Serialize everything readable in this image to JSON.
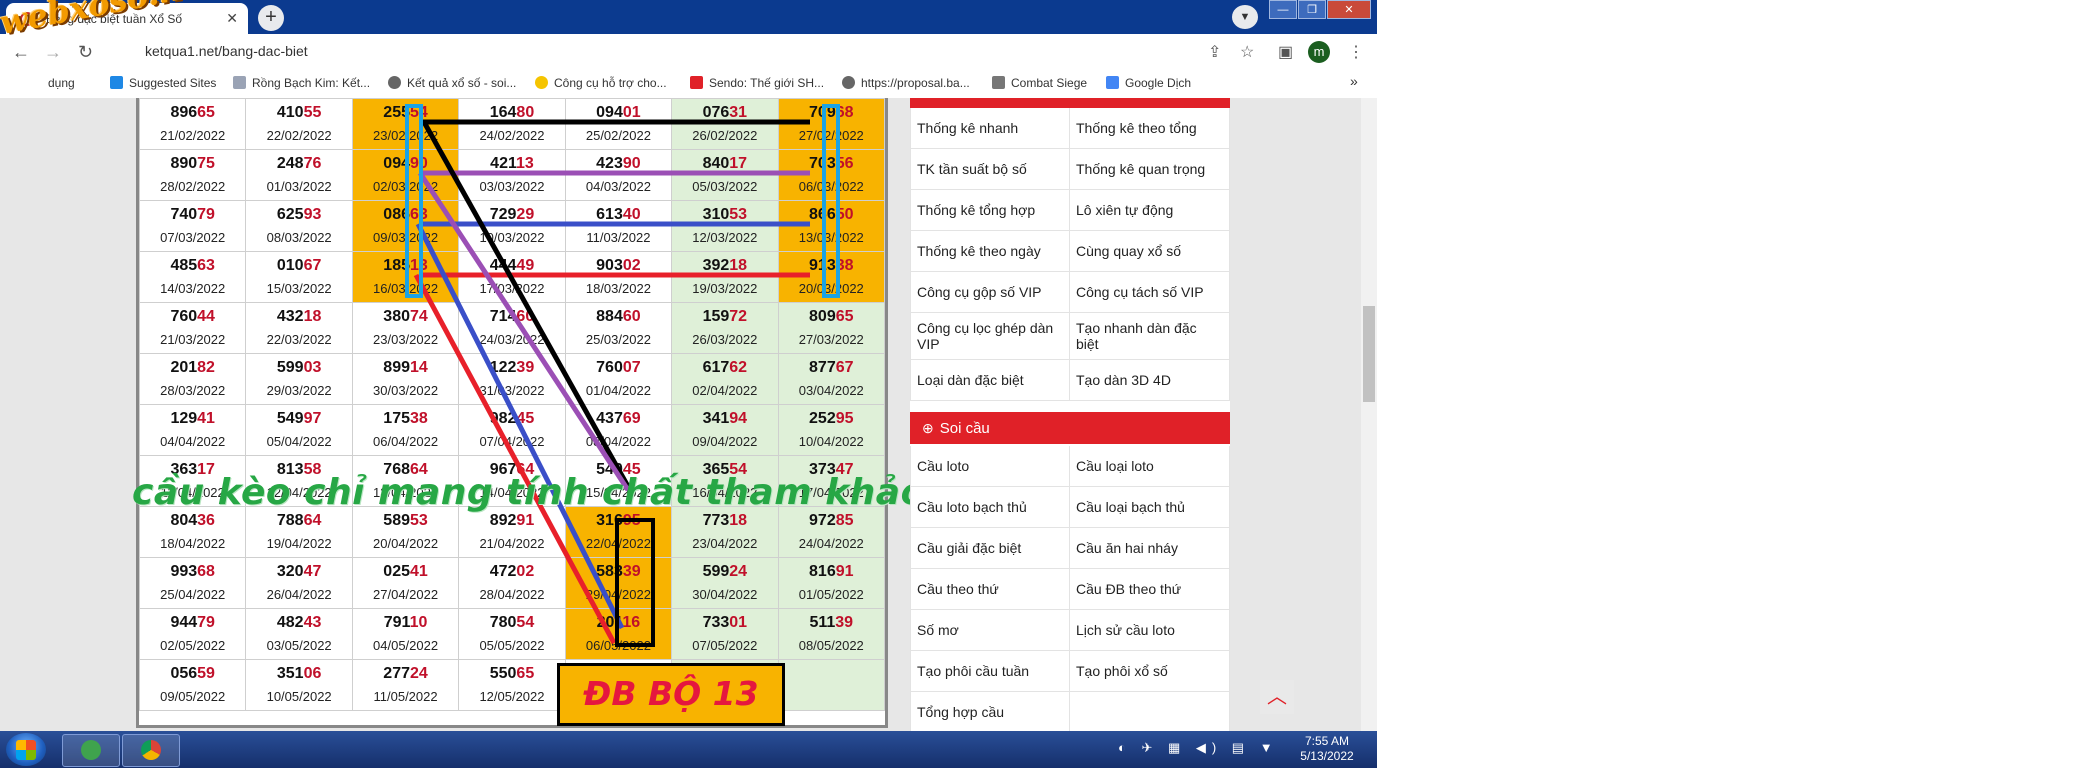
{
  "browser": {
    "tab_title": "Bảng đặc biệt tuần Xổ Số",
    "url": "ketqua1.net/bang-dac-biet",
    "profile_initial": "m",
    "watermark": "webxoso.net",
    "bookmarks": [
      "dụng",
      "Suggested Sites",
      "Rồng Bạch Kim: Kết...",
      "Kết quả xổ số - soi...",
      "Công cụ hỗ trợ cho...",
      "Sendo: Thế giới SH...",
      "https://proposal.ba...",
      "Combat Siege",
      "Google Dịch"
    ]
  },
  "table": {
    "rows": [
      [
        {
          "head": "896",
          "tail": "65",
          "date": "21/02/2022"
        },
        {
          "head": "410",
          "tail": "55",
          "date": "22/02/2022"
        },
        {
          "head": "255",
          "tail": "54",
          "date": "23/02/2022"
        },
        {
          "head": "164",
          "tail": "80",
          "date": "24/02/2022"
        },
        {
          "head": "094",
          "tail": "01",
          "date": "25/02/2022"
        },
        {
          "head": "076",
          "tail": "31",
          "date": "26/02/2022"
        },
        {
          "head": "709",
          "tail": "68",
          "date": "27/02/2022"
        }
      ],
      [
        {
          "head": "890",
          "tail": "75",
          "date": "28/02/2022"
        },
        {
          "head": "248",
          "tail": "76",
          "date": "01/03/2022"
        },
        {
          "head": "094",
          "tail": "90",
          "date": "02/03/2022"
        },
        {
          "head": "421",
          "tail": "13",
          "date": "03/03/2022"
        },
        {
          "head": "423",
          "tail": "90",
          "date": "04/03/2022"
        },
        {
          "head": "840",
          "tail": "17",
          "date": "05/03/2022"
        },
        {
          "head": "703",
          "tail": "56",
          "date": "06/03/2022"
        }
      ],
      [
        {
          "head": "740",
          "tail": "79",
          "date": "07/03/2022"
        },
        {
          "head": "625",
          "tail": "93",
          "date": "08/03/2022"
        },
        {
          "head": "086",
          "tail": "63",
          "date": "09/03/2022"
        },
        {
          "head": "729",
          "tail": "29",
          "date": "10/03/2022"
        },
        {
          "head": "613",
          "tail": "40",
          "date": "11/03/2022"
        },
        {
          "head": "310",
          "tail": "53",
          "date": "12/03/2022"
        },
        {
          "head": "866",
          "tail": "50",
          "date": "13/03/2022"
        }
      ],
      [
        {
          "head": "485",
          "tail": "63",
          "date": "14/03/2022"
        },
        {
          "head": "010",
          "tail": "67",
          "date": "15/03/2022"
        },
        {
          "head": "185",
          "tail": "13",
          "date": "16/03/2022"
        },
        {
          "head": "444",
          "tail": "49",
          "date": "17/03/2022"
        },
        {
          "head": "903",
          "tail": "02",
          "date": "18/03/2022"
        },
        {
          "head": "392",
          "tail": "18",
          "date": "19/03/2022"
        },
        {
          "head": "913",
          "tail": "38",
          "date": "20/03/2022"
        }
      ],
      [
        {
          "head": "760",
          "tail": "44",
          "date": "21/03/2022"
        },
        {
          "head": "432",
          "tail": "18",
          "date": "22/03/2022"
        },
        {
          "head": "380",
          "tail": "74",
          "date": "23/03/2022"
        },
        {
          "head": "714",
          "tail": "60",
          "date": "24/03/2022"
        },
        {
          "head": "884",
          "tail": "60",
          "date": "25/03/2022"
        },
        {
          "head": "159",
          "tail": "72",
          "date": "26/03/2022"
        },
        {
          "head": "809",
          "tail": "65",
          "date": "27/03/2022"
        }
      ],
      [
        {
          "head": "201",
          "tail": "82",
          "date": "28/03/2022"
        },
        {
          "head": "599",
          "tail": "03",
          "date": "29/03/2022"
        },
        {
          "head": "899",
          "tail": "14",
          "date": "30/03/2022"
        },
        {
          "head": "122",
          "tail": "39",
          "date": "31/03/2022"
        },
        {
          "head": "760",
          "tail": "07",
          "date": "01/04/2022"
        },
        {
          "head": "617",
          "tail": "62",
          "date": "02/04/2022"
        },
        {
          "head": "877",
          "tail": "67",
          "date": "03/04/2022"
        }
      ],
      [
        {
          "head": "129",
          "tail": "41",
          "date": "04/04/2022"
        },
        {
          "head": "549",
          "tail": "97",
          "date": "05/04/2022"
        },
        {
          "head": "175",
          "tail": "38",
          "date": "06/04/2022"
        },
        {
          "head": "982",
          "tail": "45",
          "date": "07/04/2022"
        },
        {
          "head": "437",
          "tail": "69",
          "date": "08/04/2022"
        },
        {
          "head": "341",
          "tail": "94",
          "date": "09/04/2022"
        },
        {
          "head": "252",
          "tail": "95",
          "date": "10/04/2022"
        }
      ],
      [
        {
          "head": "363",
          "tail": "17",
          "date": "11/04/2022"
        },
        {
          "head": "813",
          "tail": "58",
          "date": "12/04/2022"
        },
        {
          "head": "768",
          "tail": "64",
          "date": "13/04/2022"
        },
        {
          "head": "967",
          "tail": "64",
          "date": "14/04/2022"
        },
        {
          "head": "540",
          "tail": "45",
          "date": "15/04/2022"
        },
        {
          "head": "365",
          "tail": "54",
          "date": "16/04/2022"
        },
        {
          "head": "373",
          "tail": "47",
          "date": "17/04/2022"
        }
      ],
      [
        {
          "head": "804",
          "tail": "36",
          "date": "18/04/2022"
        },
        {
          "head": "788",
          "tail": "64",
          "date": "19/04/2022"
        },
        {
          "head": "589",
          "tail": "53",
          "date": "20/04/2022"
        },
        {
          "head": "892",
          "tail": "91",
          "date": "21/04/2022"
        },
        {
          "head": "316",
          "tail": "95",
          "date": "22/04/2022"
        },
        {
          "head": "773",
          "tail": "18",
          "date": "23/04/2022"
        },
        {
          "head": "972",
          "tail": "85",
          "date": "24/04/2022"
        }
      ],
      [
        {
          "head": "993",
          "tail": "68",
          "date": "25/04/2022"
        },
        {
          "head": "320",
          "tail": "47",
          "date": "26/04/2022"
        },
        {
          "head": "025",
          "tail": "41",
          "date": "27/04/2022"
        },
        {
          "head": "472",
          "tail": "02",
          "date": "28/04/2022"
        },
        {
          "head": "583",
          "tail": "39",
          "date": "29/04/2022"
        },
        {
          "head": "599",
          "tail": "24",
          "date": "30/04/2022"
        },
        {
          "head": "816",
          "tail": "91",
          "date": "01/05/2022"
        }
      ],
      [
        {
          "head": "944",
          "tail": "79",
          "date": "02/05/2022"
        },
        {
          "head": "482",
          "tail": "43",
          "date": "03/05/2022"
        },
        {
          "head": "791",
          "tail": "10",
          "date": "04/05/2022"
        },
        {
          "head": "780",
          "tail": "54",
          "date": "05/05/2022"
        },
        {
          "head": "201",
          "tail": "16",
          "date": "06/05/2022"
        },
        {
          "head": "733",
          "tail": "01",
          "date": "07/05/2022"
        },
        {
          "head": "511",
          "tail": "39",
          "date": "08/05/2022"
        }
      ],
      [
        {
          "head": "056",
          "tail": "59",
          "date": "09/05/2022"
        },
        {
          "head": "351",
          "tail": "06",
          "date": "10/05/2022"
        },
        {
          "head": "277",
          "tail": "24",
          "date": "11/05/2022"
        },
        {
          "head": "550",
          "tail": "65",
          "date": "12/05/2022"
        }
      ]
    ]
  },
  "overlay": {
    "caption": "cầu kèo chỉ mang tính chất tham khảo",
    "result_box": "ĐB BỘ 13",
    "colors": {
      "black": "#000000",
      "purple": "#9b4fb5",
      "blue": "#3a4fc8",
      "red": "#e8202a",
      "cyan": "#1aa3e6"
    }
  },
  "sidebar": {
    "links_top": [
      [
        "Thống kê nhanh",
        "Thống kê theo tổng"
      ],
      [
        "TK tần suất bộ số",
        "Thống kê quan trọng"
      ],
      [
        "Thống kê tổng hợp",
        "Lô xiên tự động"
      ],
      [
        "Thống kê theo ngày",
        "Cùng quay xổ số"
      ],
      [
        "Công cụ gộp số VIP",
        "Công cụ tách số VIP"
      ],
      [
        "Công cụ lọc ghép dàn VIP",
        "Tạo nhanh dàn đặc biệt"
      ],
      [
        "Loại dàn đặc biệt",
        "Tạo dàn 3D 4D"
      ]
    ],
    "soi_cau_title": "Soi cầu",
    "links_soi": [
      [
        "Cầu loto",
        "Cầu loại loto"
      ],
      [
        "Cầu loto bạch thủ",
        "Cầu loại bạch thủ"
      ],
      [
        "Cầu giải đặc biệt",
        "Cầu ăn hai nháy"
      ],
      [
        "Cầu theo thứ",
        "Cầu ĐB theo thứ"
      ],
      [
        "Số mơ",
        "Lịch sử cầu loto"
      ],
      [
        "Tạo phôi cầu tuần",
        "Tạo phôi xổ số"
      ],
      [
        "Tổng hợp cầu",
        ""
      ]
    ]
  },
  "taskbar": {
    "time": "7:55 AM",
    "date": "5/13/2022"
  }
}
